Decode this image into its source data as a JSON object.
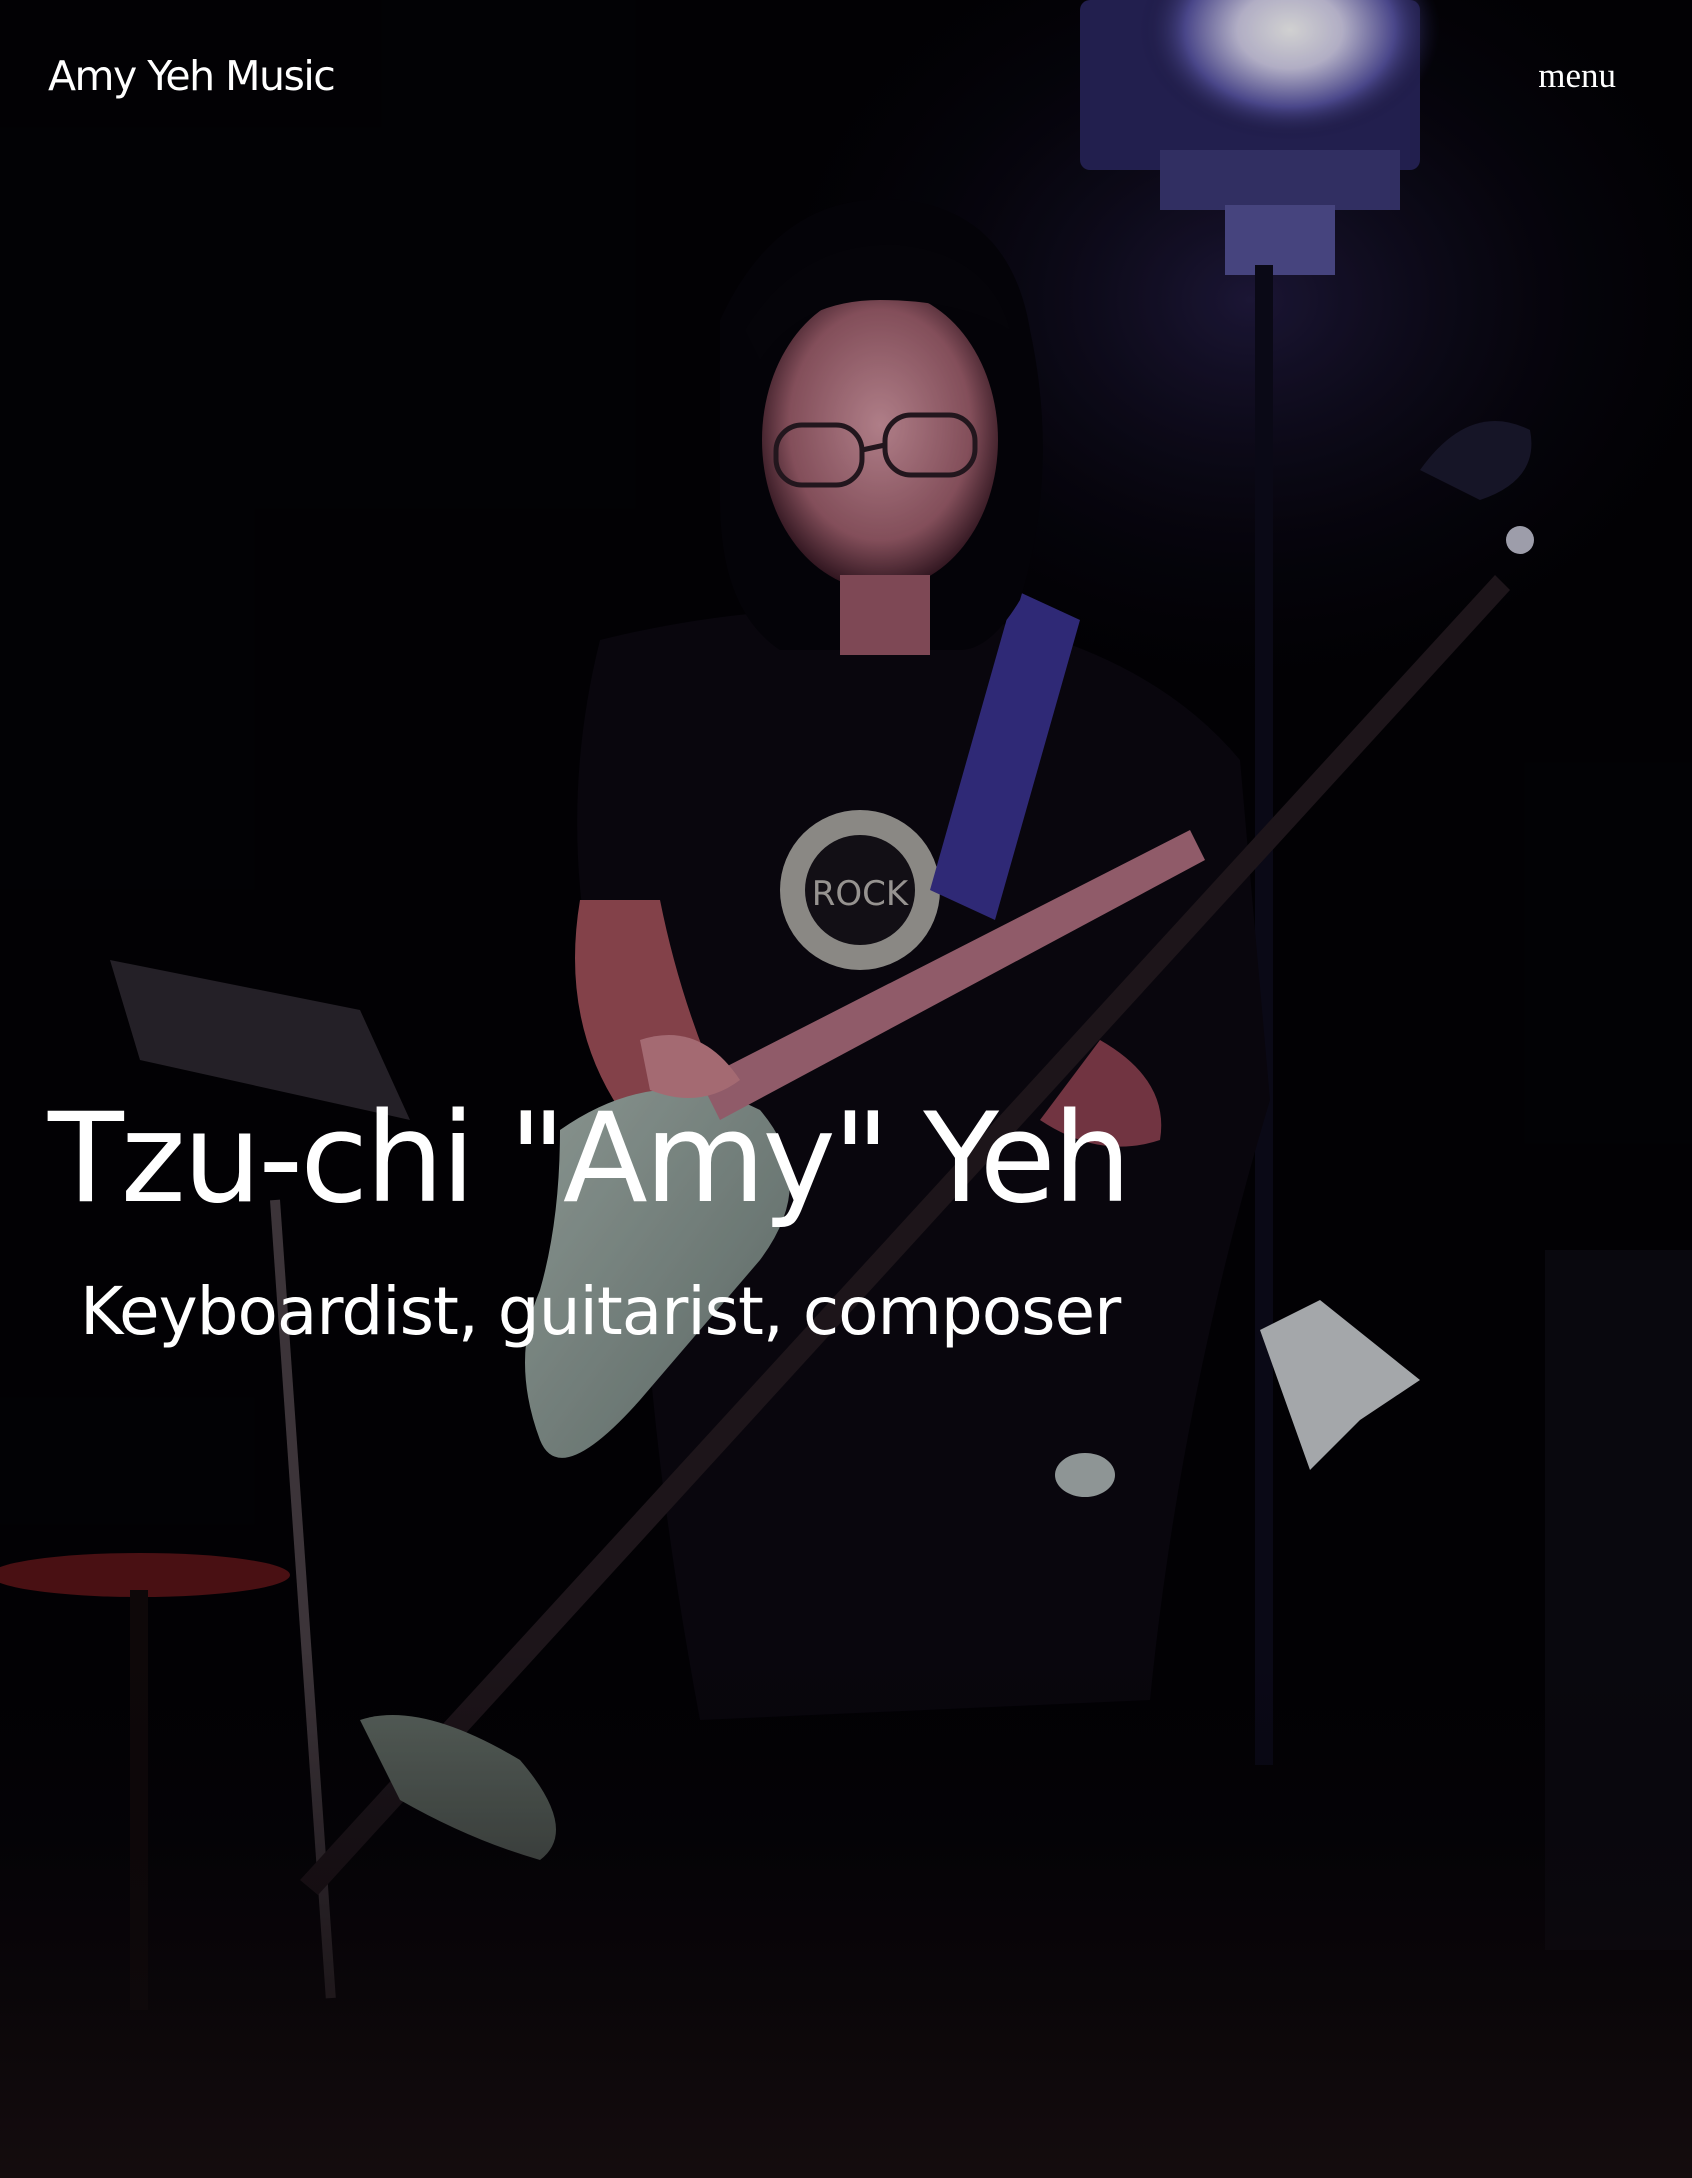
{
  "header": {
    "site_title": "Amy Yeh Music",
    "menu_label": "menu"
  },
  "hero": {
    "heading": "Tzu-chi \"Amy\" Yeh",
    "subheading": "Keyboardist, guitarist, composer",
    "photo_description_icon": "performer-photo"
  },
  "colors": {
    "background": "#030206",
    "text": "#ffffff"
  }
}
